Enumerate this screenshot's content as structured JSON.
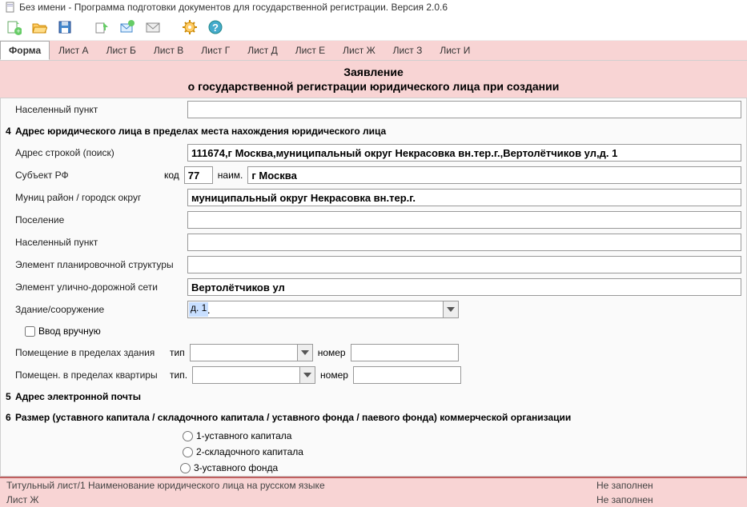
{
  "window": {
    "title": "Без имени - Программа подготовки документов для государственной регистрации. Версия 2.0.6"
  },
  "toolbar_icons": [
    "new",
    "open",
    "save",
    "export",
    "send",
    "mail",
    "settings",
    "help"
  ],
  "tabs": [
    "Форма",
    "Лист А",
    "Лист Б",
    "Лист В",
    "Лист Г",
    "Лист Д",
    "Лист Е",
    "Лист Ж",
    "Лист З",
    "Лист И"
  ],
  "active_tab": 0,
  "header": {
    "title": "Заявление",
    "subtitle": "о государственной регистрации юридического лица при создании"
  },
  "form": {
    "top_field": {
      "label": "Населенный пункт",
      "value": ""
    },
    "section4": {
      "num": "4",
      "title": "Адрес юридического лица в пределах места нахождения юридического лица",
      "addr_label": "Адрес строкой (поиск)",
      "addr_value": "111674,г Москва,муниципальный округ Некрасовка вн.тер.г.,Вертолётчиков ул,д. 1",
      "subj_label": "Субъект РФ",
      "subj_code_label": "код",
      "subj_code": "77",
      "subj_name_label": "наим.",
      "subj_name": "г Москва",
      "munic_label": "Муниц район / городск округ",
      "munic_value": "муниципальный округ Некрасовка вн.тер.г.",
      "settlement_label": "Поселение",
      "settlement_value": "",
      "locality_label": "Населенный пункт",
      "locality_value": "",
      "plan_label": "Элемент планировочной структуры",
      "plan_value": "",
      "street_label": "Элемент улично-дорожной сети",
      "street_value": "Вертолётчиков ул",
      "building_label": "Здание/сооружение",
      "building_value": "д. 1",
      "manual_label": "Ввод вручную",
      "room_label": "Помещение в пределах здания",
      "room_type_label": "тип",
      "room_num_label": "номер",
      "apt_label": "Помещен. в пределах квартиры",
      "apt_type_label": "тип.",
      "apt_num_label": "номер"
    },
    "section5": {
      "num": "5",
      "title": "Адрес электронной почты"
    },
    "section6": {
      "num": "6",
      "title": "Размер (уставного капитала / складочного капитала / уставного фонда  / паевого фонда)  коммерческой организации",
      "opt1": "1-уставного капитала",
      "opt2": "2-складочного капитала",
      "opt3": "3-уставного фонда"
    }
  },
  "bottom": {
    "row1_left": "Титульный лист/1 Наименование юридического лица на русском языке",
    "row1_right": "Не заполнен",
    "row2_left": "Лист Ж",
    "row2_right": "Не заполнен"
  }
}
